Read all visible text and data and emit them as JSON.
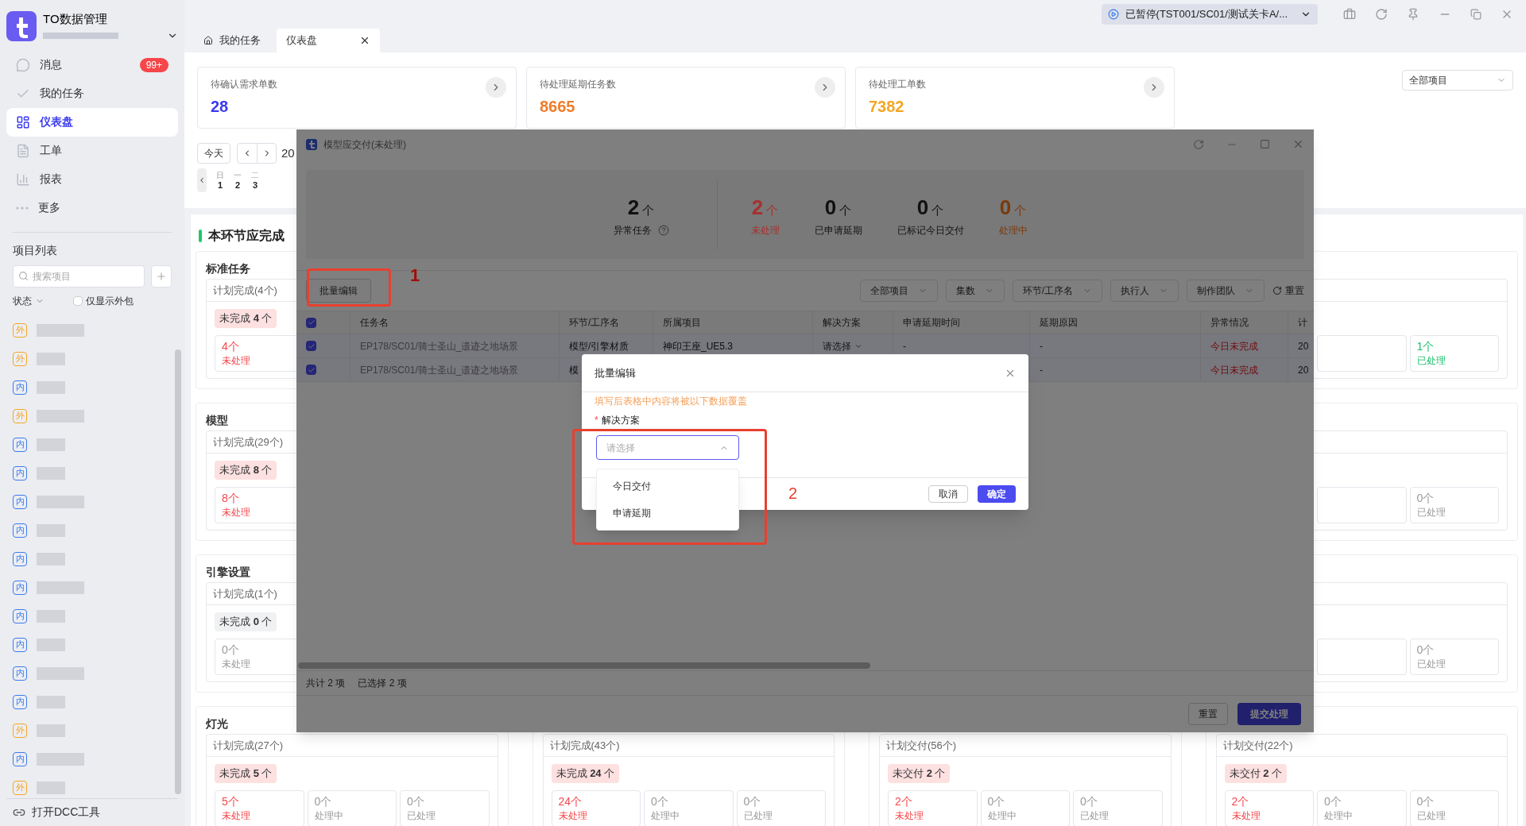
{
  "app": {
    "name": "TO数据管理"
  },
  "nav": [
    {
      "label": "消息",
      "badge": "99+",
      "selected": false
    },
    {
      "label": "我的任务",
      "selected": false
    },
    {
      "label": "仪表盘",
      "selected": true
    },
    {
      "label": "工单",
      "selected": false
    },
    {
      "label": "报表",
      "selected": false
    },
    {
      "label": "更多",
      "selected": false
    }
  ],
  "project_list": {
    "title": "项目列表",
    "search_placeholder": "搜索项目",
    "status_filter": "状态",
    "outsourced_only": {
      "label": "仅显示外包",
      "checked": false
    },
    "items": [
      {
        "tag": "外",
        "kind": "external"
      },
      {
        "tag": "外",
        "kind": "external"
      },
      {
        "tag": "内",
        "kind": "internal"
      },
      {
        "tag": "外",
        "kind": "external"
      },
      {
        "tag": "内",
        "kind": "internal"
      },
      {
        "tag": "内",
        "kind": "internal"
      },
      {
        "tag": "内",
        "kind": "internal"
      },
      {
        "tag": "内",
        "kind": "internal"
      },
      {
        "tag": "内",
        "kind": "internal"
      },
      {
        "tag": "内",
        "kind": "internal"
      },
      {
        "tag": "内",
        "kind": "internal"
      },
      {
        "tag": "内",
        "kind": "internal"
      },
      {
        "tag": "内",
        "kind": "internal"
      },
      {
        "tag": "内",
        "kind": "internal"
      },
      {
        "tag": "外",
        "kind": "external"
      },
      {
        "tag": "内",
        "kind": "internal"
      },
      {
        "tag": "外",
        "kind": "external"
      }
    ]
  },
  "footer_link": "打开DCC工具",
  "top_bar": {
    "status": "已暂停(TST001/SC01/测试关卡A/..."
  },
  "tabs": [
    {
      "label": "我的任务",
      "selected": false,
      "closable": false
    },
    {
      "label": "仪表盘",
      "selected": true,
      "closable": true
    }
  ],
  "stat_cards": [
    {
      "title": "待确认需求单数",
      "value": "28",
      "color": "#3b3bf0"
    },
    {
      "title": "待处理延期任务数",
      "value": "8665",
      "color": "#f07c2a"
    },
    {
      "title": "待处理工单数",
      "value": "7382",
      "color": "#f5a623"
    }
  ],
  "project_filter": "全部项目",
  "date_nav": {
    "today": "今天",
    "label": "20",
    "days": [
      {
        "weekday": "日",
        "day": "1"
      },
      {
        "weekday": "一",
        "day": "2"
      },
      {
        "weekday": "二",
        "day": "3"
      }
    ]
  },
  "section": {
    "title": "本环节应完成",
    "groups": [
      {
        "columns": [
          {
            "title": "标准任务",
            "plan": "计划完成(4个)",
            "badge": "未完成 **4** 个",
            "alert": true,
            "boxes": [
              {
                "count": "4个",
                "status": "未处理",
                "color": "#f5474a"
              }
            ]
          },
          {
            "boxes": [
              {
                "count": "1个",
                "status": "已处理",
                "color": "#19be6b"
              }
            ]
          }
        ]
      },
      {
        "columns": [
          {
            "title": "模型",
            "plan": "计划完成(29个)",
            "badge": "未完成 **8** 个",
            "alert": true,
            "boxes": [
              {
                "count": "8个",
                "status": "未处理",
                "color": "#f5474a"
              }
            ]
          },
          {
            "boxes": [
              {
                "count": "0个",
                "status": "已处理",
                "color": "#999999"
              }
            ]
          }
        ]
      },
      {
        "columns": [
          {
            "title": "引擎设置",
            "plan": "计划完成(1个)",
            "badge": "未完成 **0** 个",
            "alert": false,
            "boxes": [
              {
                "count": "0个",
                "status": "未处理",
                "color": "#999999"
              }
            ]
          },
          {
            "boxes": [
              {
                "count": "0个",
                "status": "已处理",
                "color": "#999999"
              }
            ]
          }
        ]
      },
      {
        "columns": [
          {
            "title": "灯光",
            "plan": "计划完成(27个)",
            "badge": "未完成 **5** 个",
            "alert": true,
            "boxes": [
              {
                "count": "5个",
                "status": "未处理",
                "color": "#f5474a"
              },
              {
                "count": "0个",
                "status": "处理中",
                "color": "#999999"
              },
              {
                "count": "0个",
                "status": "已处理",
                "color": "#999999"
              }
            ]
          },
          {
            "plan": "计划完成(43个)",
            "badge": "未完成 **24** 个",
            "alert": true,
            "boxes": [
              {
                "count": "24个",
                "status": "未处理",
                "color": "#f5474a"
              },
              {
                "count": "0个",
                "status": "处理中",
                "color": "#999999"
              },
              {
                "count": "0个",
                "status": "已处理",
                "color": "#999999"
              }
            ]
          },
          {
            "plan": "计划交付(56个)",
            "badge": "未交付 **2** 个",
            "alert": true,
            "boxes": [
              {
                "count": "2个",
                "status": "未处理",
                "color": "#f5474a"
              },
              {
                "count": "0个",
                "status": "处理中",
                "color": "#999999"
              },
              {
                "count": "0个",
                "status": "已处理",
                "color": "#999999"
              }
            ]
          },
          {
            "plan": "计划交付(22个)",
            "badge": "未交付 **2** 个",
            "alert": true,
            "boxes": [
              {
                "count": "2个",
                "status": "未处理",
                "color": "#f5474a"
              },
              {
                "count": "0个",
                "status": "处理中",
                "color": "#999999"
              },
              {
                "count": "0个",
                "status": "已处理",
                "color": "#999999"
              }
            ]
          }
        ]
      }
    ]
  },
  "modal": {
    "title": "模型应交付(未处理)",
    "summary": [
      {
        "value": "2",
        "unit": "个",
        "label": "异常任务",
        "color": "#111111",
        "help": true
      },
      {
        "value": "2",
        "unit": "个",
        "label": "未处理",
        "color": "#a8302f",
        "help": false
      },
      {
        "value": "0",
        "unit": "个",
        "label": "已申请延期",
        "color": "#111111",
        "help": false
      },
      {
        "value": "0",
        "unit": "个",
        "label": "已标记今日交付",
        "color": "#111111",
        "help": false
      },
      {
        "value": "0",
        "unit": "个",
        "label": "处理中",
        "color": "#7a3a0c",
        "help": false
      }
    ],
    "batch_edit": "批量编辑",
    "filters": [
      "全部项目",
      "集数",
      "环节/工序名",
      "执行人",
      "制作团队"
    ],
    "reset_filters": "重置",
    "table": {
      "all_checked": true,
      "columns": [
        "任务名",
        "环节/工序名",
        "所属项目",
        "解决方案",
        "申请延期时间",
        "延期原因",
        "异常情况",
        "计"
      ],
      "rows": [
        {
          "checked": true,
          "task": "EP178/SC01/骑士圣山_遗迹之地场景",
          "step": "模型/引擎材质",
          "project": "神印王座_UE5.3",
          "solution": "请选择",
          "apply_time": "-",
          "reason": "-",
          "status": "今日未完成",
          "column_9": "20"
        },
        {
          "checked": true,
          "task": "EP178/SC01/骑士圣山_遗迹之地场景",
          "step": "模",
          "reason": "-",
          "status": "今日未完成",
          "column_9": "20"
        }
      ]
    },
    "footer": {
      "total": "共计 2 项",
      "selected": "已选择 2 项"
    },
    "buttons": [
      {
        "label": "重置",
        "kind": "default"
      },
      {
        "label": "提交处理",
        "kind": "primary"
      }
    ]
  },
  "dialog": {
    "title": "批量编辑",
    "warning": "填写后表格中内容将被以下数据覆盖",
    "required_mark": "*",
    "field_label": "解决方案",
    "placeholder": "请选择",
    "options": [
      "今日交付",
      "申请延期"
    ],
    "buttons": [
      {
        "label": "取消",
        "kind": "default"
      },
      {
        "label": "确定",
        "kind": "primary"
      }
    ]
  },
  "annotations": [
    {
      "label": "1"
    },
    {
      "label": "2"
    }
  ]
}
